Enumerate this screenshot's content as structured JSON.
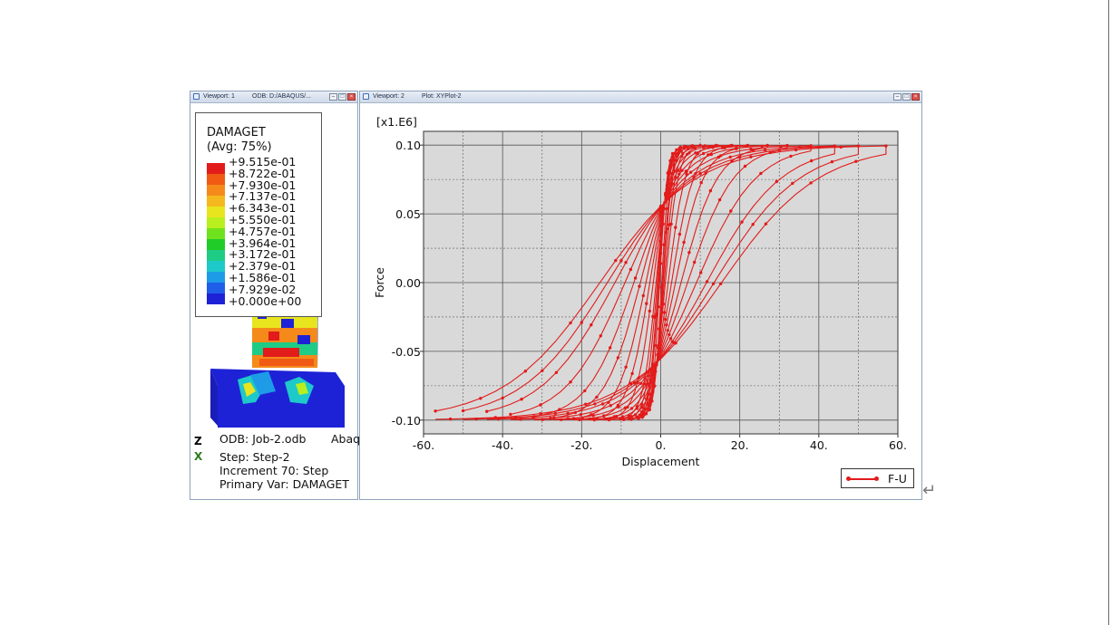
{
  "viewport1": {
    "title_label": "Viewport: 1",
    "odb_label": "ODB: D:/ABAQUS/...",
    "legend": {
      "variable": "DAMAGET",
      "average": "(Avg: 75%)",
      "values": [
        "+9.515e-01",
        "+8.722e-01",
        "+7.930e-01",
        "+7.137e-01",
        "+6.343e-01",
        "+5.550e-01",
        "+4.757e-01",
        "+3.964e-01",
        "+3.172e-01",
        "+2.379e-01",
        "+1.586e-01",
        "+7.929e-02",
        "+0.000e+00"
      ],
      "colors": [
        "#e21b1b",
        "#f05a13",
        "#f58a1a",
        "#f5b81e",
        "#e8e51e",
        "#b9ef1e",
        "#6fe21e",
        "#1fcc28",
        "#1ecc86",
        "#1ec9c9",
        "#1e9be6",
        "#1e5ee8",
        "#1e22d6"
      ]
    },
    "info": {
      "odb": "ODB: Job-2.odb",
      "abaqus": "Abaqus",
      "step": "Step: Step-2",
      "increment": "Increment      70: Step",
      "primary_var": "Primary Var: DAMAGET"
    },
    "triad": {
      "z": "Z",
      "x": "X"
    }
  },
  "viewport2": {
    "title_label": "Viewport: 2",
    "plot_label": "Plot: XYPlot-2"
  },
  "chart_data": {
    "type": "line",
    "title": "",
    "xlabel": "Displacement",
    "ylabel": "Force",
    "y_multiplier": "[x1.E6]",
    "xlim": [
      -60,
      60
    ],
    "ylim": [
      -0.11,
      0.11
    ],
    "x_ticks": [
      "-60.",
      "-40.",
      "-20.",
      "0.",
      "20.",
      "40.",
      "60."
    ],
    "y_ticks": [
      "-0.10",
      "-0.05",
      "0.00",
      "0.05",
      "0.10"
    ],
    "grid": "major solid, minor dotted",
    "background": "#d9d9d9",
    "series_color": "#e21b1b",
    "legend_position": "bottom-right",
    "series": [
      {
        "name": "F-U",
        "cycles_amplitude": [
          3,
          5,
          6,
          8,
          10,
          14,
          18,
          22,
          27,
          32,
          38,
          44,
          50,
          57
        ],
        "peak_force": 0.102
      }
    ]
  },
  "return_glyph": "↵"
}
